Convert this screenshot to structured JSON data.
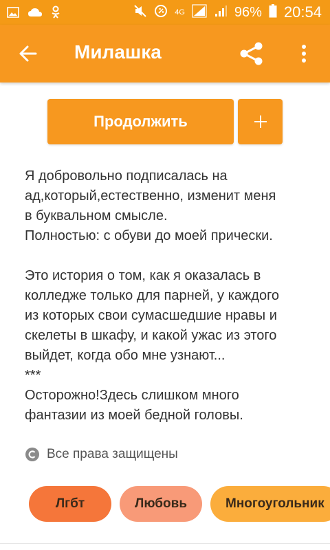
{
  "status_bar": {
    "battery_percent": "96%",
    "time": "20:54",
    "network": "4G",
    "left_icons": [
      "gallery-icon",
      "cloud-icon",
      "odnoklassniki-icon"
    ],
    "right_icons": [
      "mute-icon",
      "data-saver-icon",
      "network-4g-icon",
      "signal-icon",
      "signal-icon",
      "battery-icon"
    ]
  },
  "app_bar": {
    "title": "Милашка",
    "back_icon": "arrow-left-icon",
    "share_icon": "share-icon",
    "more_icon": "more-vert-icon"
  },
  "actions": {
    "continue_label": "Продолжить",
    "add_label": "+"
  },
  "description": {
    "lines": [
      "Я добровольно подписалась на",
      "ад,который,естественно, изменит меня",
      "в буквальном смысле.",
      "Полностью: с обуви до моей прически.",
      "",
      "Это история о том, как я оказалась в",
      "колледже только для парней, у каждого",
      "из которых свои сумасшедшие нравы и",
      "скелеты в шкафу, и какой ужас из этого",
      "выйдет, когда обо мне узнают...",
      "***",
      "Осторожно!Здесь слишком много",
      "фантазии из моей бедной головы."
    ]
  },
  "rights": {
    "label": "Все права защищены",
    "icon": "copyright-icon"
  },
  "tags": [
    {
      "label": "Лгбт",
      "color": "#f5763a"
    },
    {
      "label": "Любовь",
      "color": "#f89a78"
    },
    {
      "label": "Многоугольник",
      "color": "#fbad3c"
    }
  ],
  "colors": {
    "primary": "#f7981f",
    "status_bar": "#f49a16"
  }
}
